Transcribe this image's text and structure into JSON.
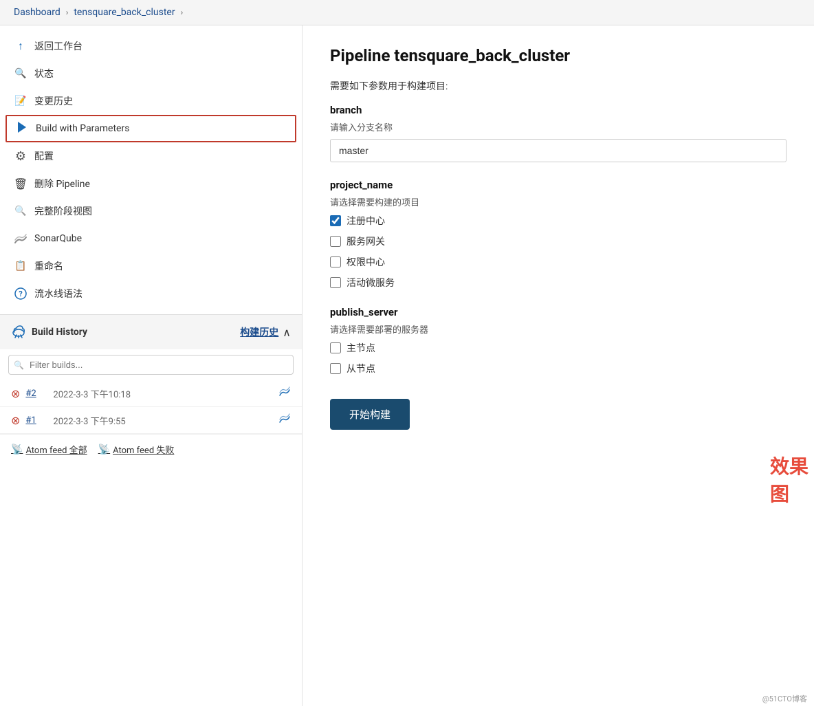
{
  "topbar": {
    "dashboard_label": "Dashboard",
    "sep1": "›",
    "project_label": "tensquare_back_cluster",
    "sep2": "›"
  },
  "sidebar": {
    "items": [
      {
        "id": "back",
        "label": "返回工作台",
        "icon": "arrow-up-icon"
      },
      {
        "id": "status",
        "label": "状态",
        "icon": "search-icon"
      },
      {
        "id": "history",
        "label": "变更历史",
        "icon": "edit-icon"
      },
      {
        "id": "build",
        "label": "Build with Parameters",
        "icon": "play-icon",
        "active": true
      },
      {
        "id": "config",
        "label": "配置",
        "icon": "gear-icon"
      },
      {
        "id": "delete",
        "label": "删除 Pipeline",
        "icon": "trash-icon"
      },
      {
        "id": "stages",
        "label": "完整阶段视图",
        "icon": "search2-icon"
      },
      {
        "id": "sonar",
        "label": "SonarQube",
        "icon": "sonar-icon"
      },
      {
        "id": "rename",
        "label": "重命名",
        "icon": "rename-icon"
      },
      {
        "id": "syntax",
        "label": "流水线语法",
        "icon": "help-icon"
      }
    ],
    "build_history": {
      "title": "Build History",
      "title_cn": "构建历史",
      "filter_placeholder": "Filter builds...",
      "builds": [
        {
          "num": "#2",
          "date": "2022-3-3 下午10:18",
          "status": "error"
        },
        {
          "num": "#1",
          "date": "2022-3-3 下午9:55",
          "status": "error"
        }
      ],
      "atom_all": "Atom feed 全部",
      "atom_fail": "Atom feed 失败"
    }
  },
  "main": {
    "title": "Pipeline tensquare_back_cluster",
    "description": "需要如下参数用于构建项目:",
    "params": {
      "branch": {
        "label": "branch",
        "hint": "请输入分支名称",
        "value": "master"
      },
      "project_name": {
        "label": "project_name",
        "hint": "请选择需要构建的项目",
        "options": [
          {
            "label": "注册中心",
            "checked": true
          },
          {
            "label": "服务网关",
            "checked": false
          },
          {
            "label": "权限中心",
            "checked": false
          },
          {
            "label": "活动微服务",
            "checked": false
          }
        ]
      },
      "watermark": "效果图",
      "publish_server": {
        "label": "publish_server",
        "hint": "请选择需要部署的服务器",
        "options": [
          {
            "label": "主节点",
            "checked": false
          },
          {
            "label": "从节点",
            "checked": false
          }
        ]
      }
    },
    "submit_label": "开始构建"
  },
  "copyright": "@51CTO博客"
}
